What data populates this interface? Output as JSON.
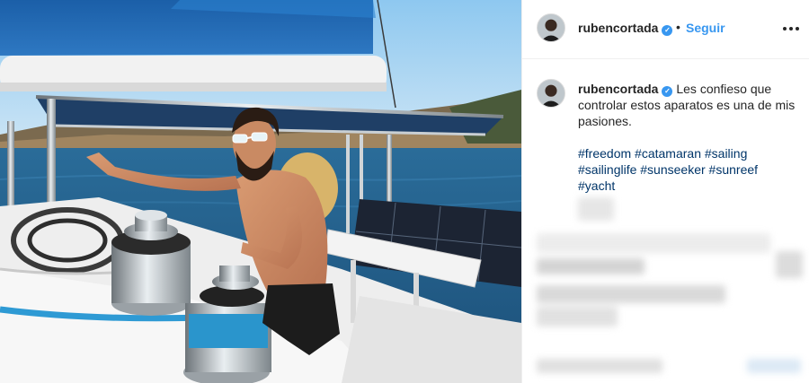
{
  "header": {
    "username": "rubencortada",
    "separator": "•",
    "follow_label": "Seguir"
  },
  "caption": {
    "username": "rubencortada",
    "text": "Les confieso que controlar estos aparatos es una de mis pasiones.",
    "hashtags": [
      "#freedom",
      "#catamaran",
      "#sailing",
      "#sailinglife",
      "#sunseeker",
      "#sunreef",
      "#yacht"
    ]
  },
  "icons": {
    "verified": "verified-badge-icon",
    "more": "more-options-icon"
  },
  "colors": {
    "accent": "#3897f0",
    "hashtag": "#003569",
    "text": "#262626"
  }
}
